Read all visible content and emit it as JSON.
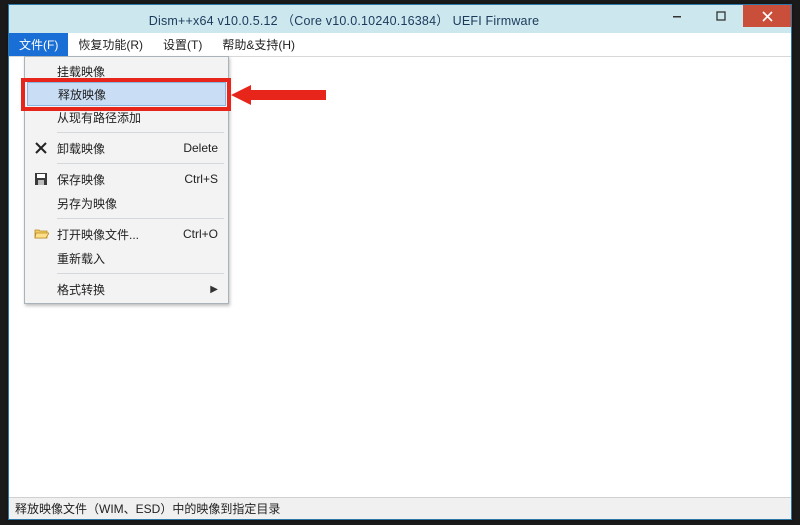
{
  "window": {
    "title": "Dism++x64 v10.0.5.12 （Core v10.0.10240.16384） UEFI Firmware"
  },
  "menubar": {
    "items": [
      {
        "label": "文件(F)",
        "active": true
      },
      {
        "label": "恢复功能(R)"
      },
      {
        "label": "设置(T)"
      },
      {
        "label": "帮助&支持(H)"
      }
    ]
  },
  "dropdown": {
    "groups": [
      [
        {
          "label": "挂载映像"
        },
        {
          "label": "释放映像",
          "highlight": true
        },
        {
          "label": "从现有路径添加"
        }
      ],
      [
        {
          "label": "卸载映像",
          "icon": "delete-x-icon",
          "shortcut": "Delete"
        }
      ],
      [
        {
          "label": "保存映像",
          "icon": "save-disk-icon",
          "shortcut": "Ctrl+S"
        },
        {
          "label": "另存为映像"
        }
      ],
      [
        {
          "label": "打开映像文件...",
          "icon": "folder-open-icon",
          "shortcut": "Ctrl+O"
        },
        {
          "label": "重新载入"
        }
      ],
      [
        {
          "label": "格式转换",
          "submenu": true
        }
      ]
    ]
  },
  "statusbar": {
    "text": "释放映像文件（WIM、ESD）中的映像到指定目录"
  }
}
